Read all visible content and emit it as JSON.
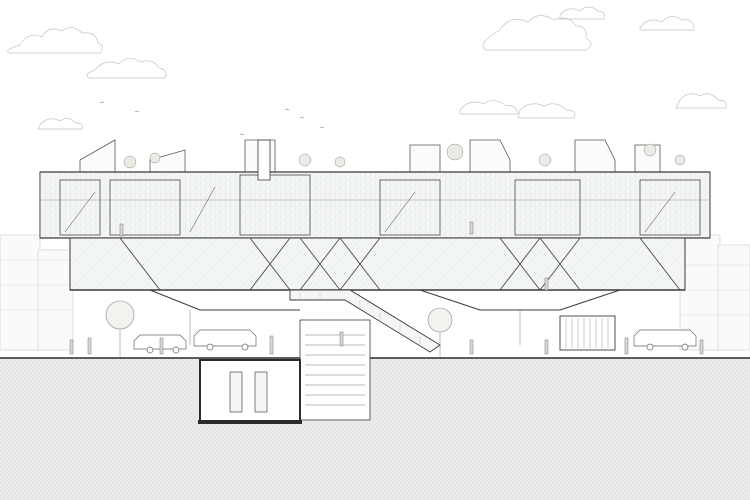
{
  "image": {
    "kind": "architectural-section-drawing",
    "palette": {
      "background": "#ffffff",
      "ink": "#3a3a3a",
      "light_ink": "#9a9a9a",
      "ground_fill": "#e6e6e6",
      "ground_hatch": "#c9c9c9",
      "glazing": "#eef1f2",
      "poche": "#2b2b2b",
      "tree": "#cfd4c8"
    },
    "elements": [
      "sky-clouds",
      "birds",
      "background-city-skyline",
      "rooftop-gardens",
      "upper-residential-floor",
      "middle-truss-floor",
      "suspended-street-canopy",
      "central-ramp",
      "basement-stair",
      "basement-storage-room",
      "shipping-container-kiosk",
      "street-trees",
      "parked-cars",
      "people-figures",
      "ground-hatch"
    ]
  }
}
